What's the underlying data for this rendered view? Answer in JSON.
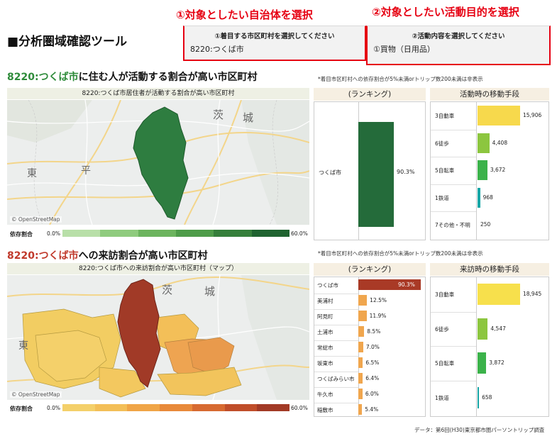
{
  "header": {
    "tool_title": "■分析圏域確認ツール",
    "annot_1": "①対象としたい自治体を選択",
    "annot_2": "②対象としたい活動目的を選択",
    "select_city_label": "①着目する市区町村を選択してください",
    "select_city_value": "8220:つくば市",
    "select_purpose_label": "②活動内容を選択してください",
    "select_purpose_value": "①買物（日用品）"
  },
  "section1": {
    "title_code": "8220:つくば市",
    "title_rest": "に住む人が活動する割合が高い市区町村",
    "note": "*着目市区町村への依存割合が5%未満orトリップ数200未満は非表示",
    "map_header": "8220:つくば市居住者が活動する割合が高い市区町村",
    "map_labels": [
      "茨",
      "城",
      "東",
      "平"
    ],
    "osm": "© OpenStreetMap",
    "legend_label": "依存割合",
    "legend_min": "0.0%",
    "legend_max": "60.0%",
    "legend_colors": [
      "#b8dfa8",
      "#8fcb7e",
      "#6cb45e",
      "#4e9c49",
      "#357f3b",
      "#1f6330"
    ],
    "ranking_header": "(ランキング)",
    "ranking": [
      {
        "name": "つくば市",
        "value": 90.3,
        "label": "90.3%"
      }
    ],
    "mode_header": "活動時の移動手段",
    "modes": [
      {
        "name": "3自動車",
        "value": 15906,
        "label": "15,906",
        "color": "#f7d94c"
      },
      {
        "name": "6徒歩",
        "value": 4408,
        "label": "4,408",
        "color": "#8cc63f"
      },
      {
        "name": "5自転車",
        "value": 3672,
        "label": "3,672",
        "color": "#3bb24a"
      },
      {
        "name": "1鉄道",
        "value": 968,
        "label": "968",
        "color": "#17a6a6"
      },
      {
        "name": "7その他・不明",
        "value": 250,
        "label": "250",
        "color": "#cccccc"
      }
    ]
  },
  "section2": {
    "title_code": "8220:つくば市",
    "title_rest": "への来訪割合が高い市区町村",
    "note": "*着目市区町村への依存割合が5%未満orトリップ数200未満は非表示",
    "map_header": "8220:つくば市への来訪割合が高い市区町村（マップ）",
    "map_labels": [
      "茨",
      "城",
      "東"
    ],
    "osm": "© OpenStreetMap",
    "legend_label": "依存割合",
    "legend_min": "0.0%",
    "legend_max": "60.0%",
    "legend_colors": [
      "#f4d06a",
      "#f3bf58",
      "#f0a547",
      "#e8893a",
      "#d76a31",
      "#c04e2a",
      "#a23a26"
    ],
    "ranking_header": "(ランキング)",
    "ranking": [
      {
        "name": "つくば市",
        "value": 90.3,
        "label": "90.3%"
      },
      {
        "name": "美浦村",
        "value": 12.5,
        "label": "12.5%"
      },
      {
        "name": "阿見町",
        "value": 11.9,
        "label": "11.9%"
      },
      {
        "name": "土浦市",
        "value": 8.5,
        "label": "8.5%"
      },
      {
        "name": "常総市",
        "value": 7.0,
        "label": "7.0%"
      },
      {
        "name": "坂東市",
        "value": 6.5,
        "label": "6.5%"
      },
      {
        "name": "つくばみらい市",
        "value": 6.4,
        "label": "6.4%"
      },
      {
        "name": "牛久市",
        "value": 6.0,
        "label": "6.0%"
      },
      {
        "name": "稲敷市",
        "value": 5.4,
        "label": "5.4%"
      }
    ],
    "mode_header": "来訪時の移動手段",
    "modes": [
      {
        "name": "3自動車",
        "value": 18945,
        "label": "18,945",
        "color": "#f7e04c"
      },
      {
        "name": "6徒歩",
        "value": 4547,
        "label": "4,547",
        "color": "#8cc63f"
      },
      {
        "name": "5自転車",
        "value": 3872,
        "label": "3,872",
        "color": "#3bb24a"
      },
      {
        "name": "1鉄道",
        "value": 658,
        "label": "658",
        "color": "#17a6a6"
      }
    ]
  },
  "source": "データ：第6回(H30)東京都市圏パーソントリップ調査"
}
